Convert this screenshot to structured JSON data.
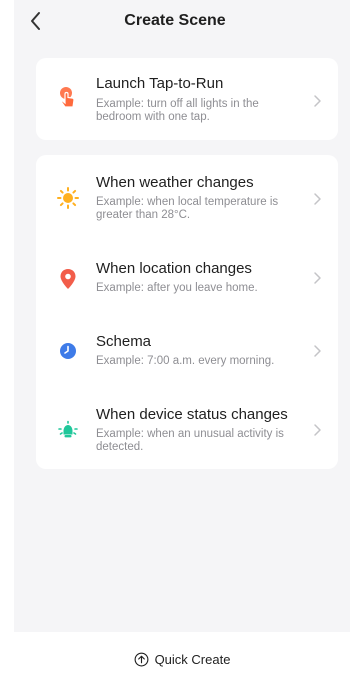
{
  "header": {
    "title": "Create Scene"
  },
  "sections": [
    {
      "items": [
        {
          "icon": "tap-hand-icon",
          "icon_color": "#ff6a3d",
          "title": "Launch Tap-to-Run",
          "description": "Example: turn off all lights in the bedroom with one tap."
        }
      ]
    },
    {
      "items": [
        {
          "icon": "sun-icon",
          "icon_color": "#ffb020",
          "title": "When weather changes",
          "description": "Example: when local temperature is greater than 28°C."
        },
        {
          "icon": "location-pin-icon",
          "icon_color": "#f25d4a",
          "title": "When location changes",
          "description": "Example: after you leave home."
        },
        {
          "icon": "clock-icon",
          "icon_color": "#3e7be8",
          "title": "Schema",
          "description": "Example: 7:00 a.m. every morning."
        },
        {
          "icon": "device-status-icon",
          "icon_color": "#1fc79a",
          "title": "When device status changes",
          "description": "Example: when an unusual activity is detected."
        }
      ]
    }
  ],
  "footer": {
    "quick_create_label": "Quick Create"
  }
}
